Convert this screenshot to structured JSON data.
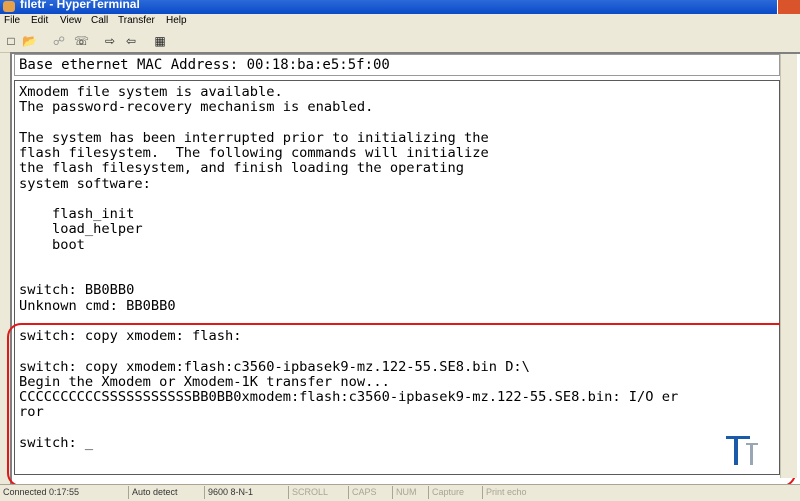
{
  "window": {
    "title": "filetr - HyperTerminal"
  },
  "menu": [
    "File",
    "Edit",
    "View",
    "Call",
    "Transfer",
    "Help"
  ],
  "toolbar": [
    "new-icon",
    "open-icon",
    "disconnect-icon",
    "phone-icon",
    "send-icon",
    "receive-icon",
    "properties-icon"
  ],
  "terminal": {
    "status_line": "Base ethernet MAC Address: 00:18:ba:e5:5f:00",
    "lines": [
      "Xmodem file system is available.",
      "The password-recovery mechanism is enabled.",
      "",
      "The system has been interrupted prior to initializing the",
      "flash filesystem.  The following commands will initialize",
      "the flash filesystem, and finish loading the operating",
      "system software:",
      "",
      "    flash_init",
      "    load_helper",
      "    boot",
      "",
      "",
      "switch: BB0BB0",
      "Unknown cmd: BB0BB0",
      "",
      "switch: copy xmodem: flash:",
      "",
      "switch: copy xmodem:flash:c3560-ipbasek9-mz.122-55.SE8.bin D:\\",
      "Begin the Xmodem or Xmodem-1K transfer now...",
      "CCCCCCCCCCSSSSSSSSSSSBB0BB0xmodem:flash:c3560-ipbasek9-mz.122-55.SE8.bin: I/O er",
      "ror",
      "",
      "switch: _"
    ]
  },
  "status": {
    "connected": "Connected 0:17:55",
    "detect": "Auto detect",
    "settings": "9600 8-N-1",
    "scroll": "SCROLL",
    "caps": "CAPS",
    "num": "NUM",
    "capture": "Capture",
    "print_echo": "Print echo"
  }
}
